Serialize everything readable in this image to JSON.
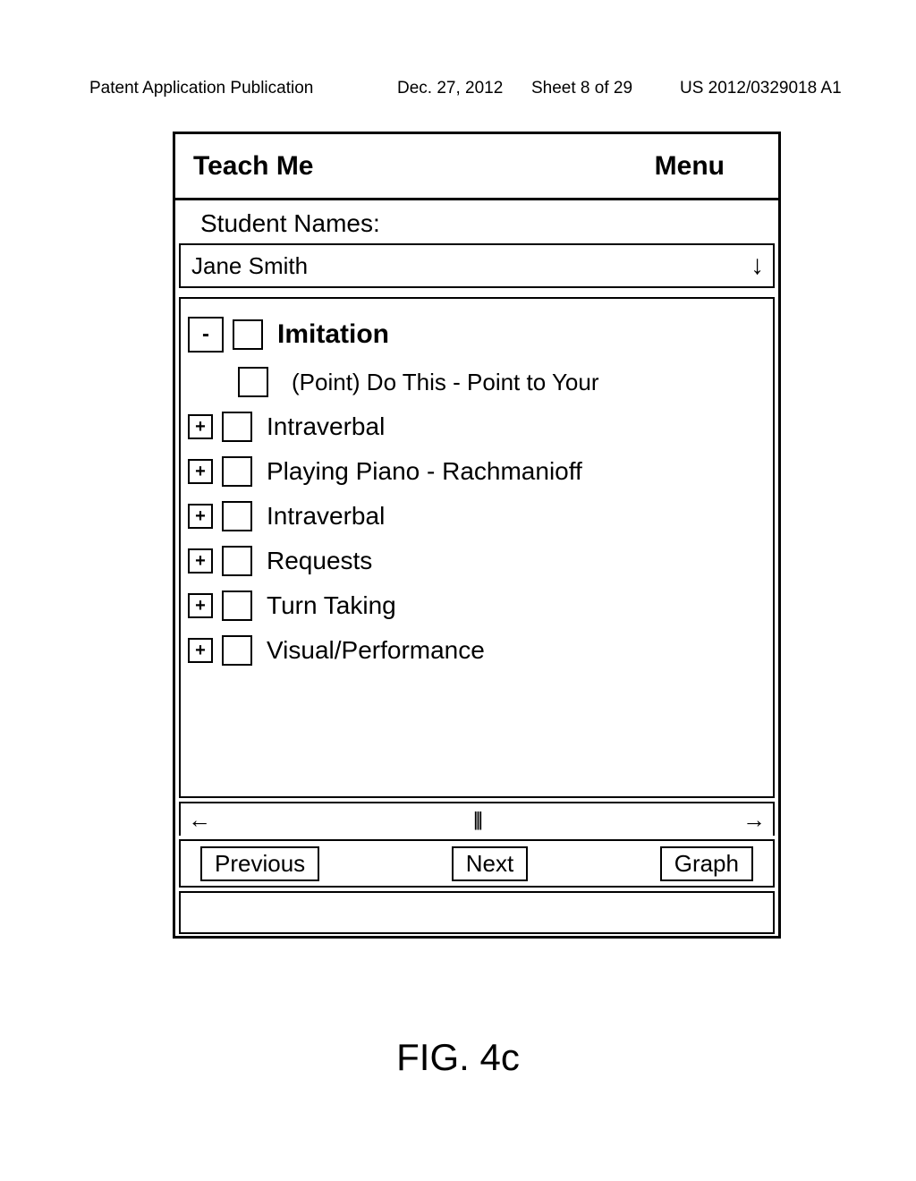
{
  "header": {
    "pub_left": "Patent Application Publication",
    "pub_date": "Dec. 27, 2012",
    "pub_sheet": "Sheet 8 of 29",
    "pub_num": "US 2012/0329018 A1"
  },
  "app": {
    "title_left": "Teach Me",
    "title_right": "Menu",
    "student_label": "Student Names:",
    "student_value": "Jane Smith",
    "tree": {
      "item0": {
        "pm": "-",
        "label": "Imitation"
      },
      "item0_sub": "(Point) Do This - Point to Your",
      "item1": {
        "pm": "+",
        "label": "Intraverbal"
      },
      "item2": {
        "pm": "+",
        "label": "Playing Piano - Rachmanioff"
      },
      "item3": {
        "pm": "+",
        "label": "Intraverbal"
      },
      "item4": {
        "pm": "+",
        "label": "Requests"
      },
      "item5": {
        "pm": "+",
        "label": "Turn Taking"
      },
      "item6": {
        "pm": "+",
        "label": "Visual/Performance"
      }
    },
    "buttons": {
      "prev": "Previous",
      "next": "Next",
      "graph": "Graph"
    }
  },
  "figure_label": "FIG. 4c"
}
